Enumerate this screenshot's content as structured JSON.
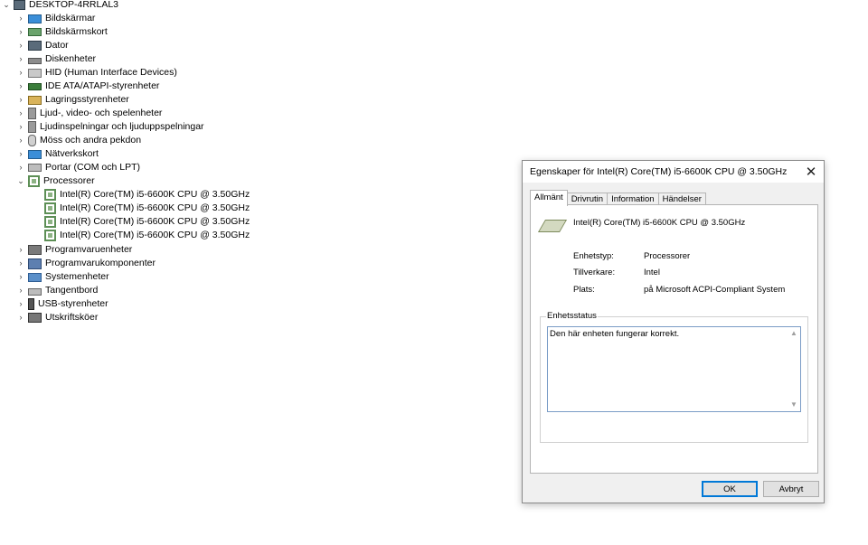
{
  "tree": {
    "root": "DESKTOP-4RRLAL3",
    "categories": [
      {
        "label": "Bildskärmar",
        "icon": "monitor-icon"
      },
      {
        "label": "Bildskärmskort",
        "icon": "display-adapter-icon"
      },
      {
        "label": "Dator",
        "icon": "computer-icon"
      },
      {
        "label": "Diskenheter",
        "icon": "disk-drive-icon"
      },
      {
        "label": "HID (Human Interface Devices)",
        "icon": "hid-icon"
      },
      {
        "label": "IDE ATA/ATAPI-styrenheter",
        "icon": "ide-controller-icon"
      },
      {
        "label": "Lagringsstyrenheter",
        "icon": "storage-controller-icon"
      },
      {
        "label": "Ljud-, video- och spelenheter",
        "icon": "speaker-icon"
      },
      {
        "label": "Ljudinspelningar och ljuduppspelningar",
        "icon": "speaker-icon"
      },
      {
        "label": "Möss och andra pekdon",
        "icon": "mouse-icon"
      },
      {
        "label": "Nätverkskort",
        "icon": "network-adapter-icon"
      },
      {
        "label": "Portar (COM och LPT)",
        "icon": "port-icon"
      },
      {
        "label": "Processorer",
        "icon": "processor-icon"
      },
      {
        "label": "Programvaruenheter",
        "icon": "software-device-icon"
      },
      {
        "label": "Programvarukomponenter",
        "icon": "software-component-icon"
      },
      {
        "label": "Systemenheter",
        "icon": "system-device-icon"
      },
      {
        "label": "Tangentbord",
        "icon": "keyboard-icon"
      },
      {
        "label": "USB-styrenheter",
        "icon": "usb-icon"
      },
      {
        "label": "Utskriftsköer",
        "icon": "printer-icon"
      }
    ],
    "processors": [
      "Intel(R) Core(TM) i5-6600K CPU @ 3.50GHz",
      "Intel(R) Core(TM) i5-6600K CPU @ 3.50GHz",
      "Intel(R) Core(TM) i5-6600K CPU @ 3.50GHz",
      "Intel(R) Core(TM) i5-6600K CPU @ 3.50GHz"
    ]
  },
  "dialog": {
    "title": "Egenskaper för Intel(R) Core(TM) i5-6600K CPU @ 3.50GHz",
    "close": "✕",
    "tabs": [
      "Allmänt",
      "Drivrutin",
      "Information",
      "Händelser"
    ],
    "device_name": "Intel(R) Core(TM) i5-6600K CPU @ 3.50GHz",
    "props": [
      {
        "label": "Enhetstyp:",
        "value": "Processorer"
      },
      {
        "label": "Tillverkare:",
        "value": "Intel"
      },
      {
        "label": "Plats:",
        "value": "på Microsoft ACPI-Compliant System"
      }
    ],
    "status_group": "Enhetsstatus",
    "status_text": "Den här enheten fungerar korrekt.",
    "ok": "OK",
    "cancel": "Avbryt"
  }
}
